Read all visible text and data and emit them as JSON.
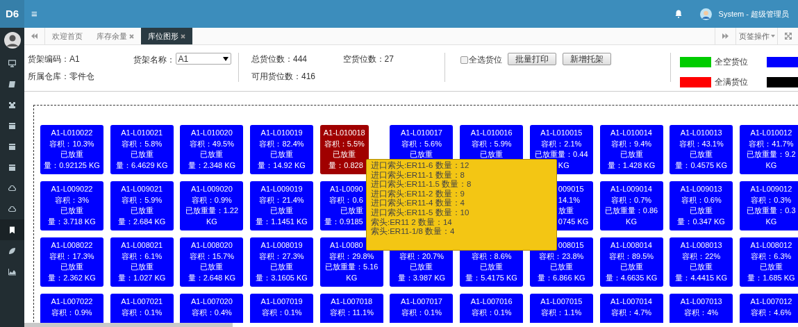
{
  "header": {
    "logo": "D6",
    "menu_glyph": "≡",
    "user": "System - 超级管理员"
  },
  "sidebar": {
    "items": [
      {
        "kind": "monitor",
        "selected": false
      },
      {
        "kind": "book",
        "selected": false
      },
      {
        "kind": "puzzle",
        "selected": false
      },
      {
        "kind": "box",
        "selected": false
      },
      {
        "kind": "box",
        "selected": false
      },
      {
        "kind": "box",
        "selected": false
      },
      {
        "kind": "cloud",
        "selected": false
      },
      {
        "kind": "cloud",
        "selected": false
      },
      {
        "kind": "bookmark",
        "selected": true
      },
      {
        "kind": "leaf",
        "selected": false
      },
      {
        "kind": "chart",
        "selected": false
      }
    ]
  },
  "tabs": [
    {
      "label": "欢迎首页",
      "closable": false,
      "selected": false
    },
    {
      "label": "库存余量",
      "closable": true,
      "selected": false
    },
    {
      "label": "库位图形",
      "closable": true,
      "selected": true
    }
  ],
  "tab_actions": {
    "label": "页签操作"
  },
  "info": {
    "shelf_code": "货架编码：A1",
    "warehouse": "所属仓库：零件仓",
    "shelf_name_label": "货架名称：",
    "shelf_name_value": "A1",
    "total": "总货位数：444",
    "available": "可用货位数：416",
    "empty": "空货位数：27",
    "select_all": {
      "label": "全选货位",
      "checked": false
    },
    "buttons": [
      "批量打印",
      "新增托架"
    ]
  },
  "legend": [
    {
      "color": "#00cc00",
      "label": "全空货位"
    },
    {
      "color": "#ff0000",
      "label": "全满货位"
    },
    {
      "color": "#0000ff"
    },
    {
      "color": "#000000"
    }
  ],
  "grid": {
    "rows": [
      {
        "cells": [
          {
            "kind": "slot",
            "color": "#0000ff",
            "code": "A1-L010022",
            "volume": "容积：10.3%",
            "weight": [
              "已放重",
              "量：0.92125 KG"
            ]
          },
          {
            "kind": "slot",
            "color": "#0000ff",
            "code": "A1-L010021",
            "volume": "容积：5.8%",
            "weight": [
              "已放重",
              "量：6.4629 KG"
            ]
          },
          {
            "kind": "slot",
            "color": "#0000ff",
            "code": "A1-L010020",
            "volume": "容积：49.5%",
            "weight": [
              "已放重",
              "量：2.348 KG"
            ]
          },
          {
            "kind": "slot",
            "color": "#0000ff",
            "code": "A1-L010019",
            "volume": "容积：82.4%",
            "weight": [
              "已放重",
              "量：14.92 KG"
            ]
          },
          {
            "kind": "slot",
            "color": "#a00000",
            "code": "A1-L010018",
            "volume": "容积：5.5%",
            "weight": [
              "已放重",
              "量：0.828"
            ]
          },
          {
            "kind": "slot",
            "color": "#0000ff",
            "code": "A1-L010017",
            "volume": "容积：5.6%",
            "weight": [
              "已放重"
            ]
          },
          {
            "kind": "slot",
            "color": "#0000ff",
            "code": "A1-L010016",
            "volume": "容积：5.9%",
            "weight": [
              "已放重"
            ]
          },
          {
            "kind": "slot",
            "color": "#0000ff",
            "code": "A1-L010015",
            "volume": "容积：2.1%",
            "weight": [
              "已放重量：0.44",
              "KG"
            ]
          },
          {
            "kind": "slot",
            "color": "#0000ff",
            "code": "A1-L010014",
            "volume": "容积：9.4%",
            "weight": [
              "已放重",
              "量：1.428 KG"
            ]
          },
          {
            "kind": "slot",
            "color": "#0000ff",
            "code": "A1-L010013",
            "volume": "容积：43.1%",
            "weight": [
              "已放重",
              "量：0.4575 KG"
            ]
          },
          {
            "kind": "slot",
            "color": "#0000ff",
            "code": "A1-L010012",
            "volume": "容积：41.7%",
            "weight": [
              "已放重量：9.2",
              "KG"
            ]
          }
        ]
      },
      {
        "cells": [
          {
            "kind": "slot",
            "color": "#0000ff",
            "code": "A1-L009022",
            "volume": "容积：3%",
            "weight": [
              "已放重",
              "量：3.718 KG"
            ]
          },
          {
            "kind": "slot",
            "color": "#0000ff",
            "code": "A1-L009021",
            "volume": "容积：5.9%",
            "weight": [
              "已放重",
              "量：2.684 KG"
            ]
          },
          {
            "kind": "slot",
            "color": "#0000ff",
            "code": "A1-L009020",
            "volume": "容积：0.9%",
            "weight": [
              "已放重量：1.22",
              "KG"
            ]
          },
          {
            "kind": "slot",
            "color": "#0000ff",
            "code": "A1-L009019",
            "volume": "容积：21.4%",
            "weight": [
              "已放重",
              "量：1.1451 KG"
            ]
          },
          {
            "kind": "slot",
            "color": "#0000ff",
            "code": "A1-L0090",
            "volume": "容积：0.6",
            "weight": [
              "已放重",
              "量：0.9185"
            ]
          },
          {
            "kind": "covered"
          },
          {
            "kind": "covered"
          },
          {
            "kind": "slot",
            "color": "#0000ff",
            "code": "009015",
            "volume": "14.1%",
            "weight": [
              "放重",
              "0745 KG"
            ]
          },
          {
            "kind": "slot",
            "color": "#0000ff",
            "code": "A1-L009014",
            "volume": "容积：0.7%",
            "weight": [
              "已放重量：0.86",
              "KG"
            ]
          },
          {
            "kind": "slot",
            "color": "#0000ff",
            "code": "A1-L009013",
            "volume": "容积：0.6%",
            "weight": [
              "已放重",
              "量：0.347 KG"
            ]
          },
          {
            "kind": "slot",
            "color": "#0000ff",
            "code": "A1-L009012",
            "volume": "容积：0.3%",
            "weight": [
              "已放重量：0.3",
              "KG"
            ]
          }
        ]
      },
      {
        "cells": [
          {
            "kind": "slot",
            "color": "#0000ff",
            "code": "A1-L008022",
            "volume": "容积：17.3%",
            "weight": [
              "已放重",
              "量：2.362 KG"
            ]
          },
          {
            "kind": "slot",
            "color": "#0000ff",
            "code": "A1-L008021",
            "volume": "容积：6.1%",
            "weight": [
              "已放重",
              "量：1.027 KG"
            ]
          },
          {
            "kind": "slot",
            "color": "#0000ff",
            "code": "A1-L008020",
            "volume": "容积：15.7%",
            "weight": [
              "已放重",
              "量：2.648 KG"
            ]
          },
          {
            "kind": "slot",
            "color": "#0000ff",
            "code": "A1-L008019",
            "volume": "容积：27.3%",
            "weight": [
              "已放重",
              "量：3.1605 KG"
            ]
          },
          {
            "kind": "slot",
            "color": "#0000ff",
            "code": "A1-L0080",
            "volume": "容积：29.8%",
            "weight": [
              "已放重量：5.16",
              "KG"
            ]
          },
          {
            "kind": "slot",
            "color": "#0000ff",
            "volume": "容积：20.7%",
            "weight": [
              "已放重",
              "量：3.987 KG"
            ]
          },
          {
            "kind": "slot",
            "color": "#0000ff",
            "volume": "容积：8.6%",
            "weight": [
              "已放重",
              "量：5.4175 KG"
            ]
          },
          {
            "kind": "slot",
            "color": "#0000ff",
            "code": "008015",
            "volume": "容积：23.8%",
            "weight": [
              "已放重",
              "量：6.866 KG"
            ]
          },
          {
            "kind": "slot",
            "color": "#0000ff",
            "code": "A1-L008014",
            "volume": "容积：89.5%",
            "weight": [
              "已放重",
              "量：4.6635 KG"
            ]
          },
          {
            "kind": "slot",
            "color": "#0000ff",
            "code": "A1-L008013",
            "volume": "容积：22%",
            "weight": [
              "已放重",
              "量：4.4415 KG"
            ]
          },
          {
            "kind": "slot",
            "color": "#0000ff",
            "code": "A1-L008012",
            "volume": "容积：6.3%",
            "weight": [
              "已放重",
              "量：1.685 KG"
            ]
          }
        ]
      },
      {
        "cells": [
          {
            "kind": "slot",
            "color": "#0000ff",
            "code": "A1-L007022",
            "volume": "容积：0.9%"
          },
          {
            "kind": "slot",
            "color": "#0000ff",
            "code": "A1-L007021",
            "volume": "容积：0.1%"
          },
          {
            "kind": "slot",
            "color": "#0000ff",
            "code": "A1-L007020",
            "volume": "容积：0.4%"
          },
          {
            "kind": "slot",
            "color": "#0000ff",
            "code": "A1-L007019",
            "volume": "容积：0.1%"
          },
          {
            "kind": "slot",
            "color": "#0000ff",
            "code": "A1-L007018",
            "volume": "容积：11.1%"
          },
          {
            "kind": "slot",
            "color": "#0000ff",
            "code": "A1-L007017",
            "volume": "容积：0.1%"
          },
          {
            "kind": "slot",
            "color": "#0000ff",
            "code": "A1-L007016",
            "volume": "容积：0.1%"
          },
          {
            "kind": "slot",
            "color": "#0000ff",
            "code": "A1-L007015",
            "volume": "容积：1.1%"
          },
          {
            "kind": "slot",
            "color": "#0000ff",
            "code": "A1-L007014",
            "volume": "容积：4.7%"
          },
          {
            "kind": "slot",
            "color": "#0000ff",
            "code": "A1-L007013",
            "volume": "容积：4%"
          },
          {
            "kind": "slot",
            "color": "#0000ff",
            "code": "A1-L007012",
            "volume": "容积：4.6%"
          }
        ]
      }
    ]
  },
  "tooltip": {
    "lines": [
      "进口索头:ER11-6 数量：12",
      "进口索头:ER11-1 数量：8",
      "进口索头:ER11-1.5 数量：8",
      "进口索头:ER11-2 数量：9",
      "进口索头:ER11-4 数量：4",
      "进口索头:ER11-5 数量：10",
      "索头:ER11 2 数量：14",
      "索头:ER11-1/8 数量：4"
    ]
  }
}
